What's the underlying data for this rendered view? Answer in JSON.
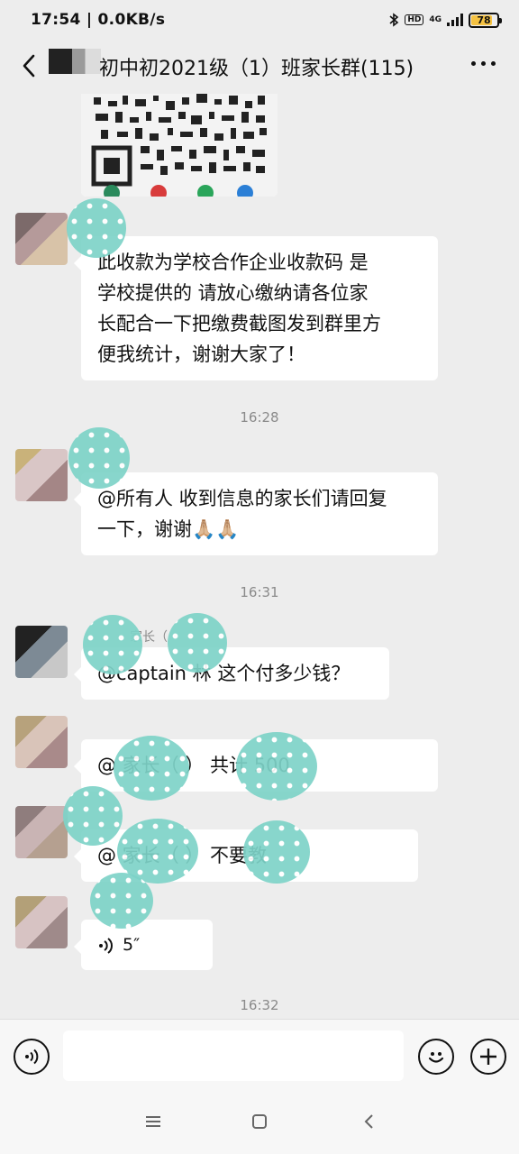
{
  "status": {
    "time_speed": "17:54 | 0.0KB/s",
    "hd": "HD",
    "network": "4G",
    "battery": "78"
  },
  "header": {
    "title": "初中初2021级（1）班家长群(115)"
  },
  "messages": [
    {
      "text_lines": [
        "此收款为学校合作企业收款码 是",
        "学校提供的 请放心缴纳请各位家",
        "长配合一下把缴费截图发到群里方",
        "便我统计，谢谢大家了！"
      ]
    },
    {
      "time": "16:28"
    },
    {
      "text_lines": [
        "@所有人 收到信息的家长们请回复",
        "一下，谢谢🙏🏼🙏🏼"
      ]
    },
    {
      "time": "16:31"
    },
    {
      "sender_fragment": "家长（",
      "text": "@captain 林  这个付多少钱？"
    },
    {
      "text": "@        家长（          ）  共计 500"
    },
    {
      "text": "@        家长（          ）  不要教"
    },
    {
      "voice_duration": "5″"
    },
    {
      "time": "16:32"
    }
  ],
  "colors": {
    "background": "#ededed",
    "bubble": "#ffffff",
    "timestamp": "#8a8a8a",
    "privacy_mask": "#7ed3c8"
  },
  "icons": [
    "back-icon",
    "more-icon",
    "voice-input-icon",
    "emoji-icon",
    "add-icon",
    "menu-icon",
    "home-icon",
    "back-nav-icon",
    "voice-message-icon"
  ]
}
